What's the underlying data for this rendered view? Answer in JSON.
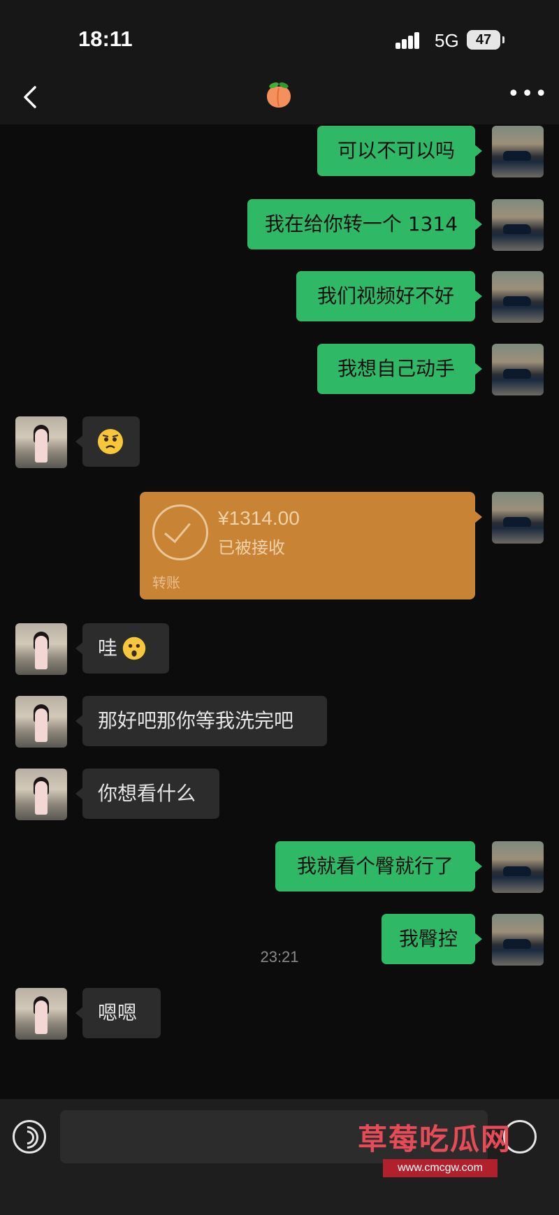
{
  "status": {
    "time": "18:11",
    "network": "5G",
    "battery": "47"
  },
  "header": {
    "title_icon": "peach-emoji",
    "back_icon": "chevron-left-icon",
    "more_icon": "more-dots-icon"
  },
  "messages": [
    {
      "side": "right",
      "text": "可以不可以吗"
    },
    {
      "side": "right",
      "text": "我在给你转一个 1314"
    },
    {
      "side": "right",
      "text": "我们视频好不好"
    },
    {
      "side": "right",
      "text": "我想自己动手"
    },
    {
      "side": "left",
      "text": "",
      "emoji": "thinking-face-emoji"
    },
    {
      "side": "right",
      "type": "transfer",
      "amount": "¥1314.00",
      "status": "已被接收",
      "label": "转账"
    },
    {
      "side": "left",
      "text": "哇",
      "emoji": "hushed-face-emoji"
    },
    {
      "side": "left",
      "text": "那好吧那你等我洗完吧"
    },
    {
      "side": "left",
      "text": "你想看什么"
    },
    {
      "side": "right",
      "text": "我就看个臀就行了"
    },
    {
      "side": "right",
      "text": "我臀控"
    },
    {
      "side": "left",
      "text": "嗯嗯"
    }
  ],
  "timestamp": "23:21",
  "input_bar": {
    "voice_icon": "voice-icon",
    "emoji_icon": "emoji-icon"
  },
  "watermark": {
    "text": "草莓吃瓜网",
    "url": "www.cmcgw.com"
  },
  "colors": {
    "sent_bubble": "#2fb866",
    "received_bubble": "#2c2c2c",
    "transfer_card": "#c98335",
    "background": "#0c0c0c"
  }
}
